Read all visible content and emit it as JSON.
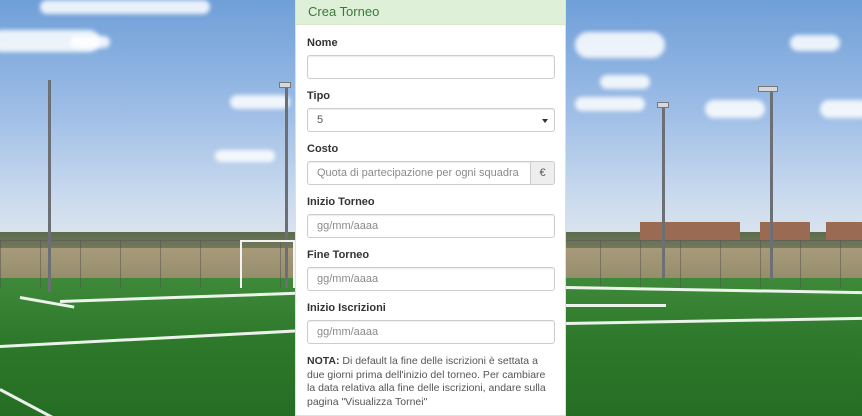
{
  "panel": {
    "title": "Crea Torneo"
  },
  "form": {
    "nome": {
      "label": "Nome",
      "value": ""
    },
    "tipo": {
      "label": "Tipo",
      "value": "5"
    },
    "costo": {
      "label": "Costo",
      "placeholder": "Quota di partecipazione per ogni squadra",
      "addon": "€"
    },
    "inizio_torneo": {
      "label": "Inizio Torneo",
      "placeholder": "gg/mm/aaaa"
    },
    "fine_torneo": {
      "label": "Fine Torneo",
      "placeholder": "gg/mm/aaaa"
    },
    "inizio_iscrizioni": {
      "label": "Inizio Iscrizioni",
      "placeholder": "gg/mm/aaaa"
    },
    "note": {
      "prefix": "NOTA:",
      "text": " Di default la fine delle iscrizioni è settata a due giorni prima dell'inizio del torneo. Per cambiare la data relativa alla fine delle iscrizioni, andare sulla pagina \"Visualizza Tornei\""
    }
  },
  "colors": {
    "heading_bg": "#dff0d8",
    "heading_text": "#3c763d",
    "border": "#d6e9c6"
  }
}
